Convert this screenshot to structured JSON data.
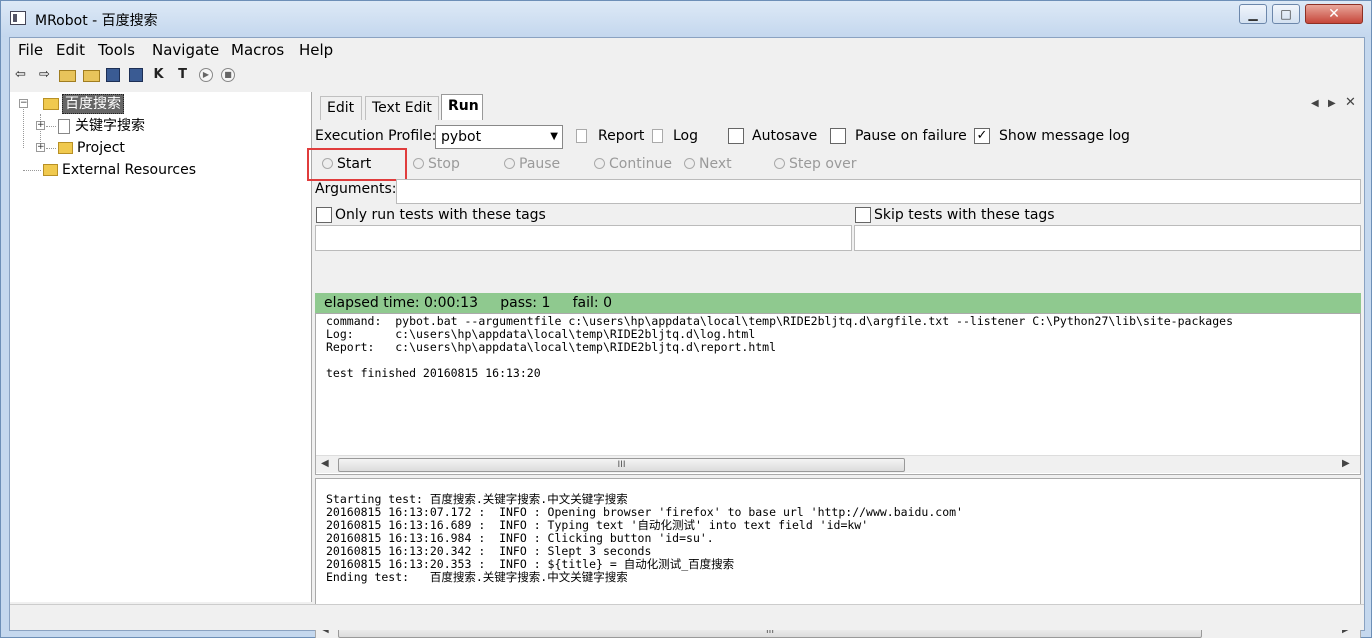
{
  "window": {
    "title": "MRobot - 百度搜索"
  },
  "menu": [
    "File",
    "Edit",
    "Tools",
    "Navigate",
    "Macros",
    "Help"
  ],
  "toolbar": {
    "icons": [
      "back-arrow-icon",
      "forward-arrow-icon",
      "open-test-suite-icon",
      "open-directory-icon",
      "save-icon",
      "save-all-icon",
      "keyword-search-icon",
      "test-search-icon",
      "run-icon",
      "stop-icon"
    ],
    "keyword_glyph": "K",
    "test_glyph": "T"
  },
  "tree": {
    "root": "百度搜索",
    "child_suite": "关键字搜索",
    "child_project": "Project",
    "external": "External Resources"
  },
  "tabs": [
    "Edit",
    "Text Edit",
    "Run"
  ],
  "run": {
    "profile_label": "Execution Profile:",
    "profile_value": "pybot",
    "report_label": "Report",
    "log_label": "Log",
    "autosave_label": "Autosave",
    "pause_label": "Pause on failure",
    "show_msg_label": "Show message log",
    "show_msg_checked": "✓",
    "buttons": {
      "start": "Start",
      "stop": "Stop",
      "pause": "Pause",
      "continue": "Continue",
      "next": "Next",
      "step_over": "Step over"
    },
    "arguments_label": "Arguments:",
    "only_tags_label": "Only run tests with these tags",
    "skip_tags_label": "Skip tests with these tags",
    "status": "elapsed time: 0:00:13     pass: 1     fail: 0",
    "output_lines": [
      "command:  pybot.bat --argumentfile c:\\users\\hp\\appdata\\local\\temp\\RIDE2bljtq.d\\argfile.txt --listener C:\\Python27\\lib\\site-packages",
      "Log:      c:\\users\\hp\\appdata\\local\\temp\\RIDE2bljtq.d\\log.html",
      "Report:   c:\\users\\hp\\appdata\\local\\temp\\RIDE2bljtq.d\\report.html",
      "",
      "test finished 20160815 16:13:20"
    ],
    "message_lines": [
      "Starting test: 百度搜索.关键字搜索.中文关键字搜索",
      "20160815 16:13:07.172 :  INFO : Opening browser 'firefox' to base url 'http://www.baidu.com'",
      "20160815 16:13:16.689 :  INFO : Typing text '自动化测试' into text field 'id=kw'",
      "20160815 16:13:16.984 :  INFO : Clicking button 'id=su'.",
      "20160815 16:13:20.342 :  INFO : Slept 3 seconds",
      "20160815 16:13:20.353 :  INFO : ${title} = 自动化测试_百度搜索",
      "Ending test:   百度搜索.关键字搜索.中文关键字搜索"
    ],
    "scroll_grip": "III"
  }
}
